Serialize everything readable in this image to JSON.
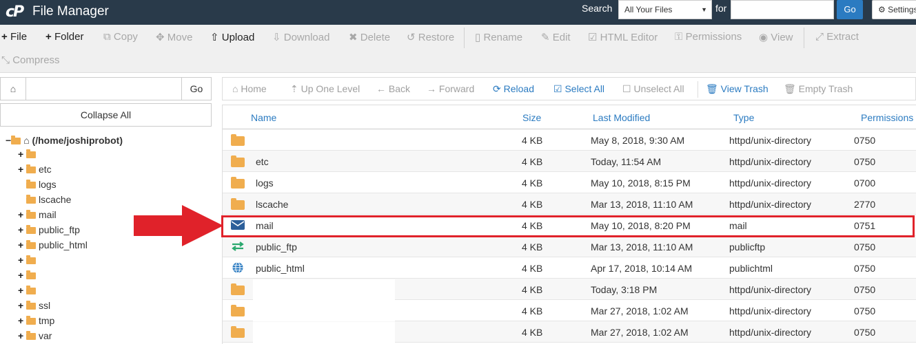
{
  "header": {
    "logo_text": "cP",
    "title": "File Manager",
    "search_label": "Search",
    "search_scope": "All Your Files",
    "for_label": "for",
    "search_value": "",
    "go_label": "Go",
    "settings_label": "Settings"
  },
  "toolbar": {
    "file": "File",
    "folder": "Folder",
    "copy": "Copy",
    "move": "Move",
    "upload": "Upload",
    "download": "Download",
    "delete": "Delete",
    "restore": "Restore",
    "rename": "Rename",
    "edit": "Edit",
    "html_editor": "HTML Editor",
    "permissions": "Permissions",
    "view": "View",
    "extract": "Extract",
    "compress": "Compress"
  },
  "left": {
    "path_value": "",
    "go_label": "Go",
    "collapse_label": "Collapse All",
    "root_label": "(/home/joshiprobot)",
    "tree": [
      {
        "label": "",
        "expandable": true
      },
      {
        "label": "etc",
        "expandable": true
      },
      {
        "label": "logs",
        "expandable": false
      },
      {
        "label": "lscache",
        "expandable": false
      },
      {
        "label": "mail",
        "expandable": true
      },
      {
        "label": "public_ftp",
        "expandable": true
      },
      {
        "label": "public_html",
        "expandable": true
      },
      {
        "label": "",
        "expandable": true
      },
      {
        "label": "",
        "expandable": true
      },
      {
        "label": "",
        "expandable": true
      },
      {
        "label": "ssl",
        "expandable": true
      },
      {
        "label": "tmp",
        "expandable": true
      },
      {
        "label": "var",
        "expandable": true
      }
    ]
  },
  "nav": {
    "home": "Home",
    "up": "Up One Level",
    "back": "Back",
    "forward": "Forward",
    "reload": "Reload",
    "select_all": "Select All",
    "unselect_all": "Unselect All",
    "view_trash": "View Trash",
    "empty_trash": "Empty Trash"
  },
  "table": {
    "columns": {
      "name": "Name",
      "size": "Size",
      "modified": "Last Modified",
      "type": "Type",
      "perms": "Permissions"
    },
    "rows": [
      {
        "icon": "folder",
        "name": "",
        "size": "4 KB",
        "modified": "May 8, 2018, 9:30 AM",
        "type": "httpd/unix-directory",
        "perms": "0750"
      },
      {
        "icon": "folder",
        "name": "etc",
        "size": "4 KB",
        "modified": "Today, 11:54 AM",
        "type": "httpd/unix-directory",
        "perms": "0750"
      },
      {
        "icon": "folder",
        "name": "logs",
        "size": "4 KB",
        "modified": "May 10, 2018, 8:15 PM",
        "type": "httpd/unix-directory",
        "perms": "0700"
      },
      {
        "icon": "folder",
        "name": "lscache",
        "size": "4 KB",
        "modified": "Mar 13, 2018, 11:10 AM",
        "type": "httpd/unix-directory",
        "perms": "2770"
      },
      {
        "icon": "mail",
        "name": "mail",
        "size": "4 KB",
        "modified": "May 10, 2018, 8:20 PM",
        "type": "mail",
        "perms": "0751"
      },
      {
        "icon": "ftp",
        "name": "public_ftp",
        "size": "4 KB",
        "modified": "Mar 13, 2018, 11:10 AM",
        "type": "publicftp",
        "perms": "0750"
      },
      {
        "icon": "globe",
        "name": "public_html",
        "size": "4 KB",
        "modified": "Apr 17, 2018, 10:14 AM",
        "type": "publichtml",
        "perms": "0750"
      },
      {
        "icon": "folder",
        "name": "",
        "size": "4 KB",
        "modified": "Today, 3:18 PM",
        "type": "httpd/unix-directory",
        "perms": "0750"
      },
      {
        "icon": "folder",
        "name": "",
        "size": "4 KB",
        "modified": "Mar 27, 2018, 1:02 AM",
        "type": "httpd/unix-directory",
        "perms": "0750"
      },
      {
        "icon": "folder",
        "name": "",
        "size": "4 KB",
        "modified": "Mar 27, 2018, 1:02 AM",
        "type": "httpd/unix-directory",
        "perms": "0750"
      }
    ]
  },
  "colors": {
    "header_bg": "#293a4a",
    "accent_blue": "#2b7bc1",
    "folder": "#f0ad4e",
    "highlight_red": "#e0222a"
  }
}
